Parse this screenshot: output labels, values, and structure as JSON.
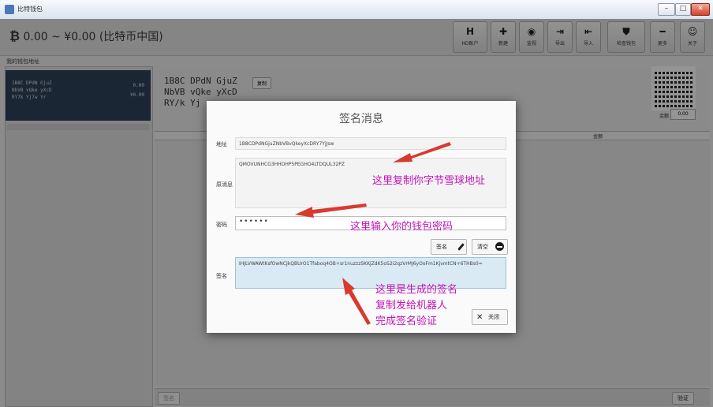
{
  "window": {
    "title": "比特钱包",
    "controls": {
      "minimize": "–",
      "maximize": "□",
      "close": "✕"
    }
  },
  "header": {
    "balance_icon": "₿",
    "balance_text": "0.00 ~ ¥0.00 (比特币中国)",
    "toolbar": [
      {
        "icon": "H",
        "label": "HD账户",
        "icon_name": "hd-account-icon"
      },
      {
        "icon": "✚",
        "label": "新建",
        "icon_name": "plus-icon"
      },
      {
        "icon": "◉",
        "label": "监视",
        "icon_name": "eye-icon"
      },
      {
        "icon": "⇥",
        "label": "导出",
        "icon_name": "export-icon"
      },
      {
        "icon": "⇤",
        "label": "导入",
        "icon_name": "import-icon"
      },
      {
        "icon": "⛊",
        "label": "检查钱包",
        "icon_name": "shield-icon"
      },
      {
        "icon": "━",
        "label": "更多",
        "icon_name": "minus-icon"
      },
      {
        "icon": "☺",
        "label": "关于",
        "icon_name": "smiley-icon"
      }
    ]
  },
  "sidebar": {
    "heading": "我的钱包地址",
    "selected_address": {
      "lines": "1B8C DPdN GjuZ\nNbVB vQke yXcD\nRY7k Yj7w Yr",
      "balance_btc": "0.00",
      "balance_cny": "¥0.00"
    }
  },
  "main": {
    "address_display": "1B8C DPdN GjuZ\nNbVB vQke yXcD\nRY/k Yj",
    "copy_label": "复制",
    "amount_label": "金额",
    "amount_value": "0.00",
    "table_headers": {
      "col2": "金额"
    },
    "bottom_left_button": "签名",
    "bottom_right_button": "验证"
  },
  "dialog": {
    "title": "签名消息",
    "address_label": "地址",
    "address_value": "1B8CDPdNGjuZNbVBvQkeyXcDRY7YjJsw",
    "message_label": "原消息",
    "message_value": "QMOVUNHCG3HHDHP5PEGHO4LTDQUL32PZ",
    "password_label": "密码",
    "password_value": "••••••",
    "sign_button": "签名",
    "clear_button": "清空",
    "signature_label": "签名",
    "signature_value": "IHJLVWAWtKsfOwNCJkQBUrO1Tfaboq4OB+sr1nuzzzSKKjZdK5oS2I2qzVrMJ6yOoFm1KjvmtCN+6THBs0=",
    "close_button": "关闭"
  },
  "annotations": {
    "copy_address": "这里复制你字节雪球地址",
    "enter_password": "这里输入你的钱包密码",
    "generated_sig_1": "这里是生成的签名",
    "generated_sig_2": "复制发给机器人",
    "generated_sig_3": "完成签名验证"
  },
  "colors": {
    "annotation": "#c214b8",
    "sidebar_selected": "#2e4258",
    "signature_field": "#d9eaf5"
  }
}
